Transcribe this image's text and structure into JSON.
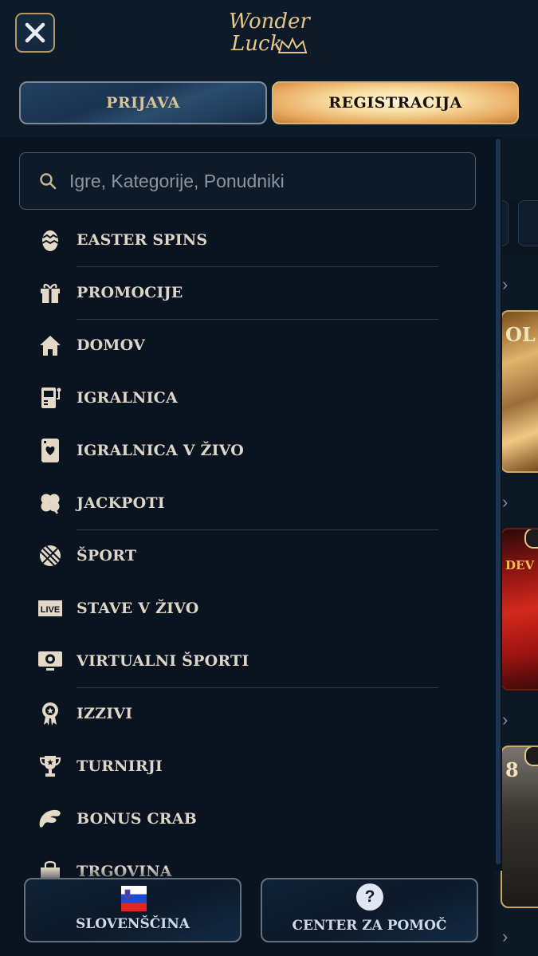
{
  "header": {
    "logo_line1": "Wonder",
    "logo_line2": "Luck",
    "login_label": "PRIJAVA",
    "register_label": "REGISTRACIJA"
  },
  "search": {
    "placeholder": "Igre, Kategorije, Ponudniki"
  },
  "menu": {
    "items": [
      {
        "label": "EASTER SPINS",
        "icon": "egg-icon"
      },
      {
        "label": "PROMOCIJE",
        "icon": "gift-icon"
      },
      {
        "label": "DOMOV",
        "icon": "home-icon"
      },
      {
        "label": "IGRALNICA",
        "icon": "slot-machine-icon"
      },
      {
        "label": "IGRALNICA V ŽIVO",
        "icon": "playing-card-icon"
      },
      {
        "label": "JACKPOTI",
        "icon": "clover-icon"
      },
      {
        "label": "ŠPORT",
        "icon": "ball-icon"
      },
      {
        "label": "STAVE V ŽIVO",
        "icon": "live-icon"
      },
      {
        "label": "VIRTUALNI ŠPORTI",
        "icon": "virtual-screen-icon"
      },
      {
        "label": "IZZIVI",
        "icon": "medal-icon"
      },
      {
        "label": "TURNIRJI",
        "icon": "trophy-icon"
      },
      {
        "label": "BONUS CRAB",
        "icon": "crab-claw-icon"
      },
      {
        "label": "TRGOVINA",
        "icon": "shopping-bag-icon"
      }
    ],
    "live_badge": "LIVE"
  },
  "footer": {
    "language_label": "SLOVENŠČINA",
    "help_label": "CENTER ZA POMOČ",
    "help_icon_text": "?"
  },
  "background": {
    "card1_text": "OL",
    "card2_text": "DEV",
    "card3_text": "8"
  },
  "colors": {
    "accent_gold": "#d6b371",
    "panel_bg": "#0a1420",
    "menu_text": "#ddd6c8"
  }
}
